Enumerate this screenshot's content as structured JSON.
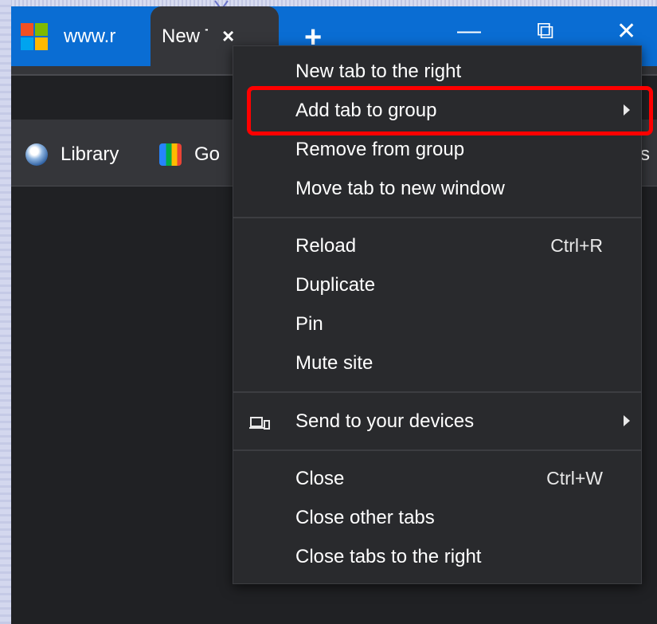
{
  "browser": {
    "tabs": [
      {
        "title": "www.r",
        "icon": "microsoft-logo"
      },
      {
        "title": "New Ta",
        "close": "×"
      }
    ],
    "new_tab": "+",
    "controls": {
      "minimize": "—",
      "restore": "⧉",
      "close": "✕"
    }
  },
  "bookmarks": [
    {
      "label": "Library",
      "icon": "library-globe-icon"
    },
    {
      "label": "Go",
      "icon": "google-meet-icon"
    }
  ],
  "bookmark_overflow": "s",
  "context_menu": {
    "items": [
      {
        "label": "New tab to the right"
      },
      {
        "label": "Add tab to group",
        "submenu": true,
        "highlighted": true
      },
      {
        "label": "Remove from group"
      },
      {
        "label": "Move tab to new window"
      },
      {
        "label": "Reload",
        "shortcut": "Ctrl+R"
      },
      {
        "label": "Duplicate"
      },
      {
        "label": "Pin"
      },
      {
        "label": "Mute site"
      },
      {
        "label": "Send to your devices",
        "submenu": true,
        "icon": "devices-icon"
      },
      {
        "label": "Close",
        "shortcut": "Ctrl+W"
      },
      {
        "label": "Close other tabs"
      },
      {
        "label": "Close tabs to the right"
      }
    ]
  },
  "colors": {
    "titlebar": "#0a6dd3",
    "menu_bg": "#292a2d",
    "highlight": "#ff0000"
  }
}
